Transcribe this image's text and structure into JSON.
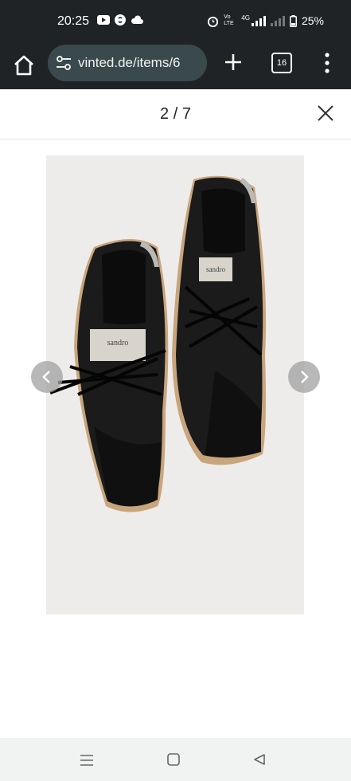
{
  "status_bar": {
    "time": "20:25",
    "network_label": "4G",
    "volte_label": "Vo LTE",
    "battery_percent": "25%",
    "icons": [
      "youtube-icon",
      "shazam-icon",
      "cloud-icon",
      "alarm-icon",
      "volte-icon",
      "signal-icon",
      "battery-icon"
    ]
  },
  "browser": {
    "url": "vinted.de/items/6",
    "tab_count": "16",
    "icons": [
      "home-icon",
      "tune-icon",
      "plus-icon",
      "tabs-icon",
      "more-vert-icon"
    ]
  },
  "viewer": {
    "counter": "2 / 7",
    "current": 2,
    "total": 7,
    "photo_description": "sandro black leather sneakers",
    "brand_tag_left": "sandro",
    "brand_tag_right": "sandro",
    "icons": [
      "close-icon",
      "chevron-left-icon",
      "chevron-right-icon"
    ]
  },
  "system_nav": {
    "icons": [
      "recents-icon",
      "home-square-icon",
      "back-triangle-icon"
    ]
  },
  "colors": {
    "status_bg": "#1f2326",
    "url_pill": "#3a4a4c",
    "nav_bg": "#f0f3f2",
    "nav_button": "#a0a0a0",
    "photo_bg": "#eeecea"
  }
}
